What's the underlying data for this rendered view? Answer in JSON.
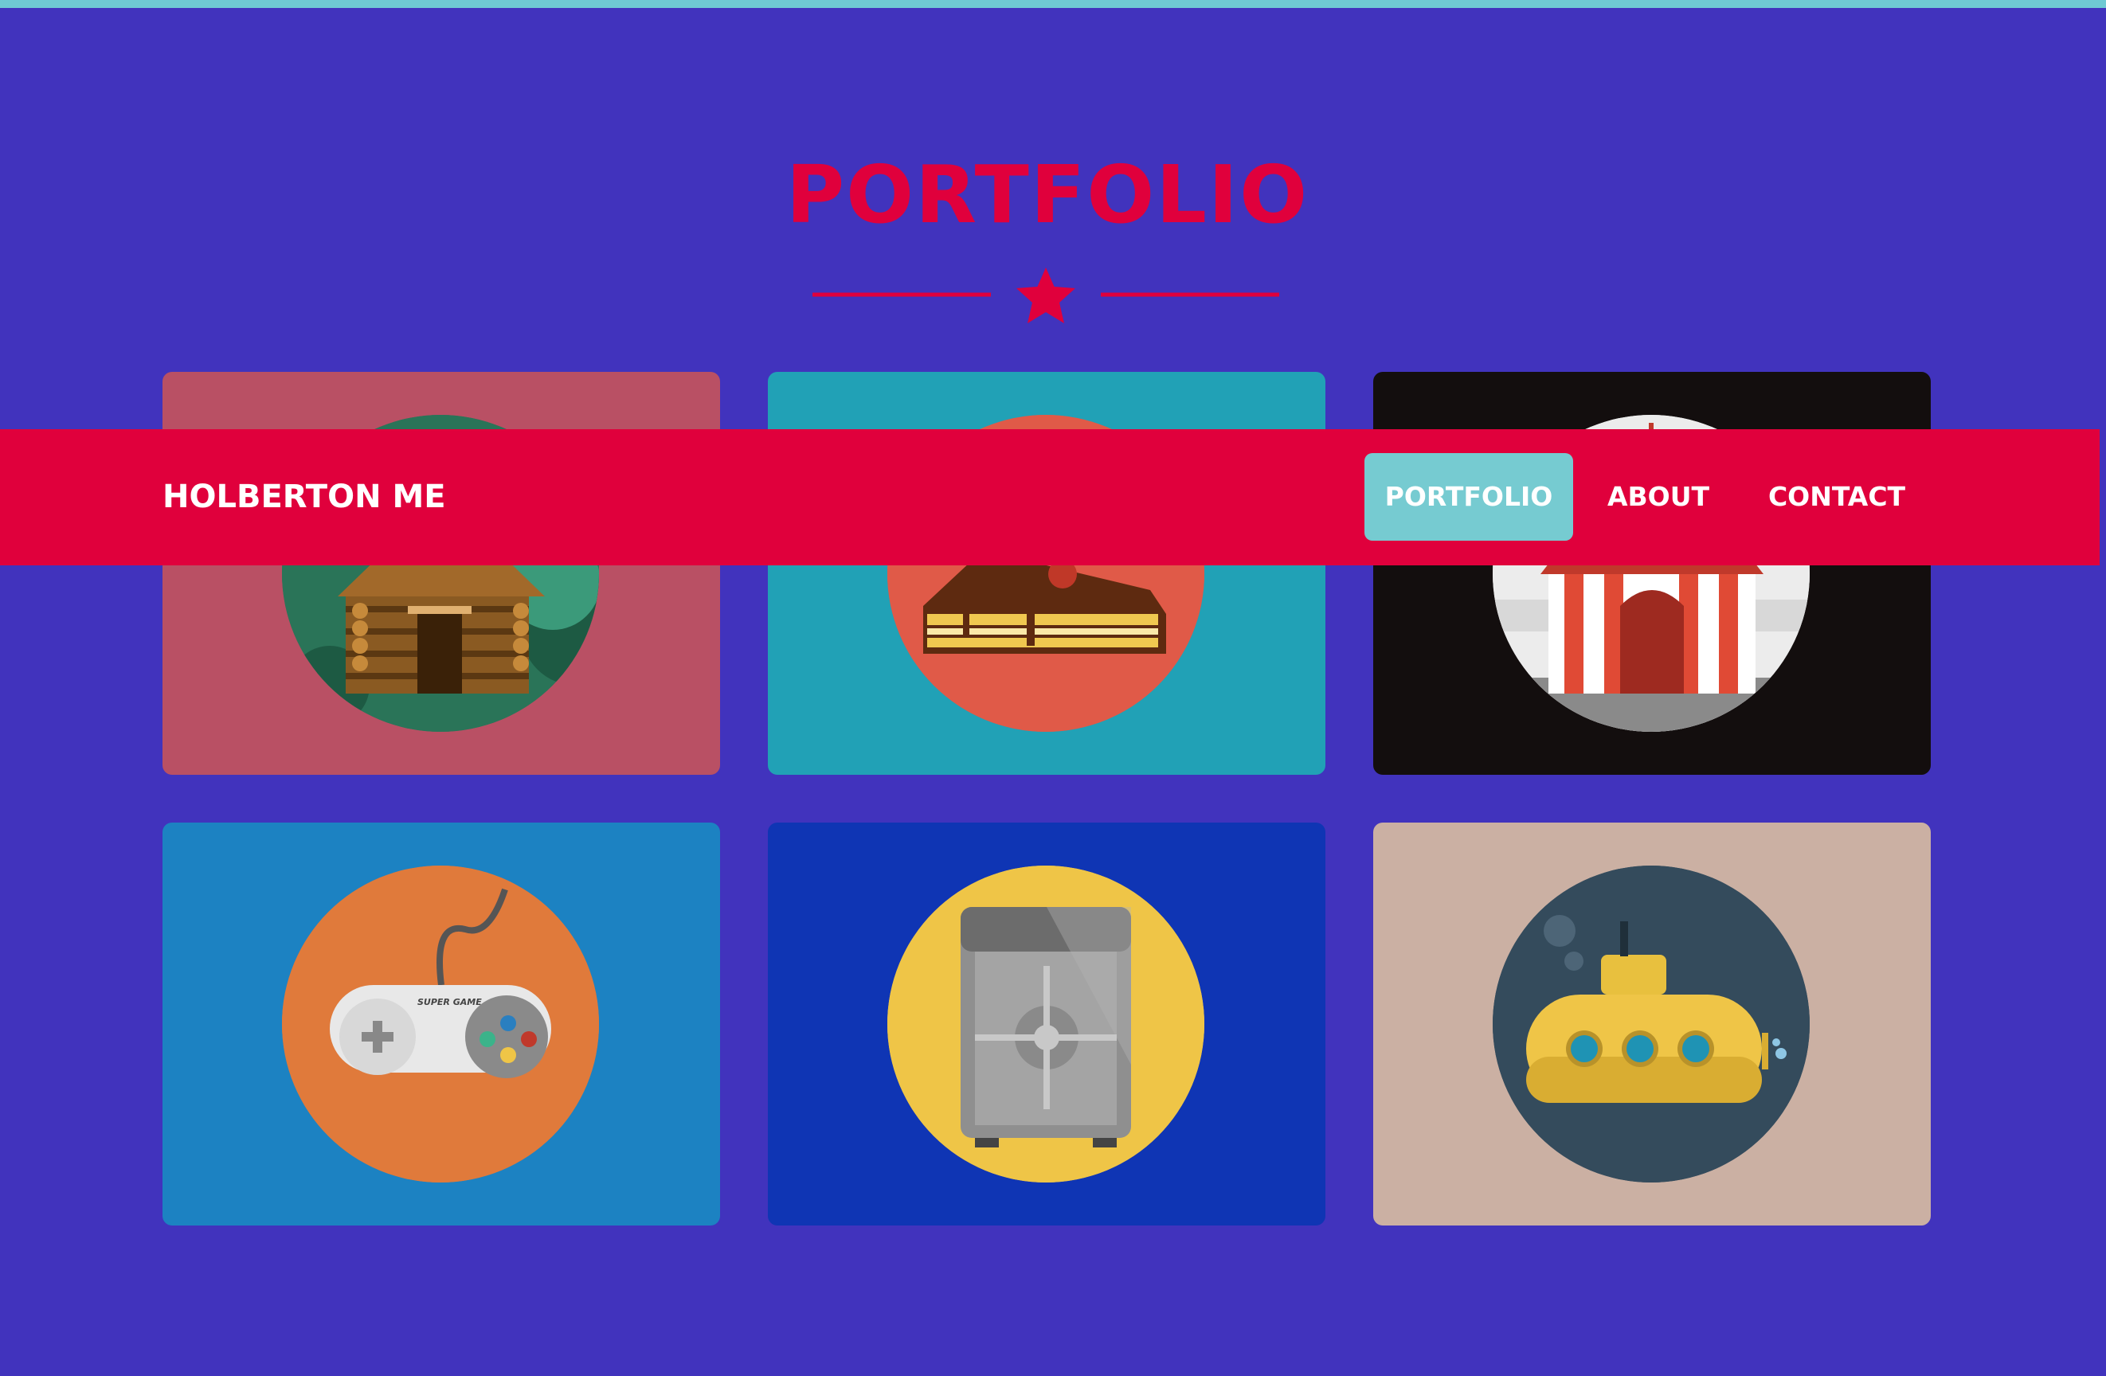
{
  "colors": {
    "background": "#4133bd",
    "accent": "#e0003c",
    "top_bar": "#6fc9d3",
    "active_nav": "#76cbd1"
  },
  "portfolio": {
    "title": "PORTFOLIO",
    "divider_icon": "star-icon",
    "items": [
      {
        "icon": "log-cabin-icon",
        "background": "#b95064",
        "disc": "#2a7458"
      },
      {
        "icon": "cake-slice-icon",
        "background": "#21a1b6",
        "disc": "#e05a48"
      },
      {
        "icon": "circus-tent-icon",
        "background": "#130e0e",
        "disc": "#ececec"
      },
      {
        "icon": "game-controller-icon",
        "background": "#1c82c2",
        "disc": "#e07a3b"
      },
      {
        "icon": "safe-icon",
        "background": "#0f35b4",
        "disc": "#efc547"
      },
      {
        "icon": "submarine-icon",
        "background": "#cbb0a3",
        "disc": "#344b5c"
      }
    ]
  },
  "navbar": {
    "brand": "HOLBERTON ME",
    "links": [
      {
        "label": "PORTFOLIO",
        "active": true
      },
      {
        "label": "ABOUT",
        "active": false
      },
      {
        "label": "CONTACT",
        "active": false
      }
    ]
  },
  "controller_label": "SUPER GAME"
}
